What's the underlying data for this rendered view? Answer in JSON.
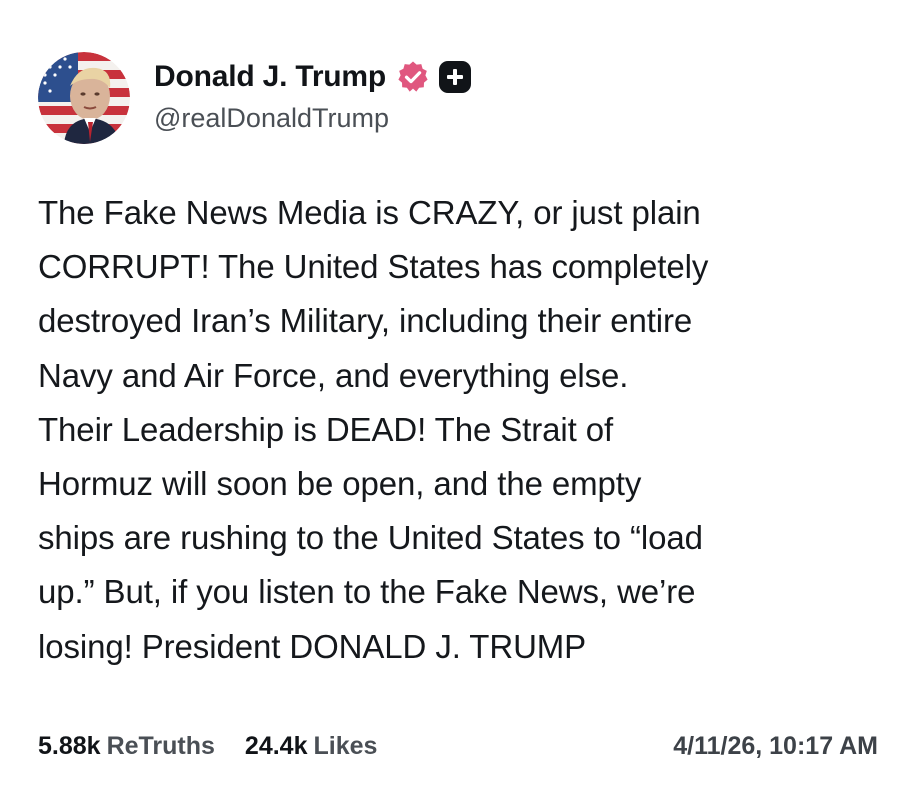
{
  "post": {
    "author": {
      "display_name": "Donald J. Trump",
      "handle": "@realDonaldTrump",
      "verified": true,
      "avatar": "profile-photo-flag-background",
      "verified_badge_color": "#e0577f",
      "follow_icon": "plus-icon"
    },
    "lines": [
      "The Fake News Media is CRAZY, or just plain",
      "CORRUPT! The United States has completely",
      "destroyed Iran’s Military, including their entire",
      "Navy and Air Force, and everything else.",
      "Their Leadership is DEAD! The Strait of",
      "Hormuz will soon be open, and the empty",
      "ships are rushing to the United States to “load",
      "up.” But, if you listen to the Fake News, we’re",
      "losing! President DONALD J. TRUMP"
    ],
    "stats": {
      "retruths_count": "5.88k",
      "retruths_label": "ReTruths",
      "likes_count": "24.4k",
      "likes_label": "Likes"
    },
    "timestamp": "4/11/26, 10:17 AM"
  }
}
